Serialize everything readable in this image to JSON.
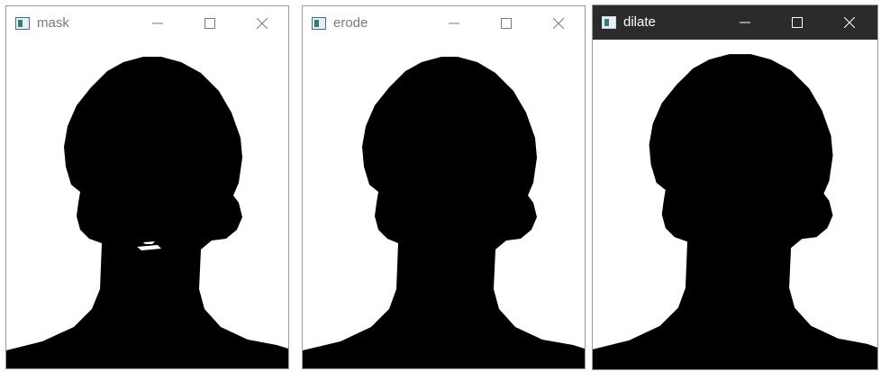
{
  "windows": [
    {
      "title": "mask",
      "active": false
    },
    {
      "title": "erode",
      "active": false
    },
    {
      "title": "dilate",
      "active": true
    }
  ],
  "controls": {
    "minimize": "minimize-icon",
    "maximize": "maximize-icon",
    "close": "close-icon"
  },
  "colors": {
    "active_titlebar": "#2b2b2b",
    "inactive_title_text": "#7a7a7a",
    "silhouette": "#000000"
  }
}
